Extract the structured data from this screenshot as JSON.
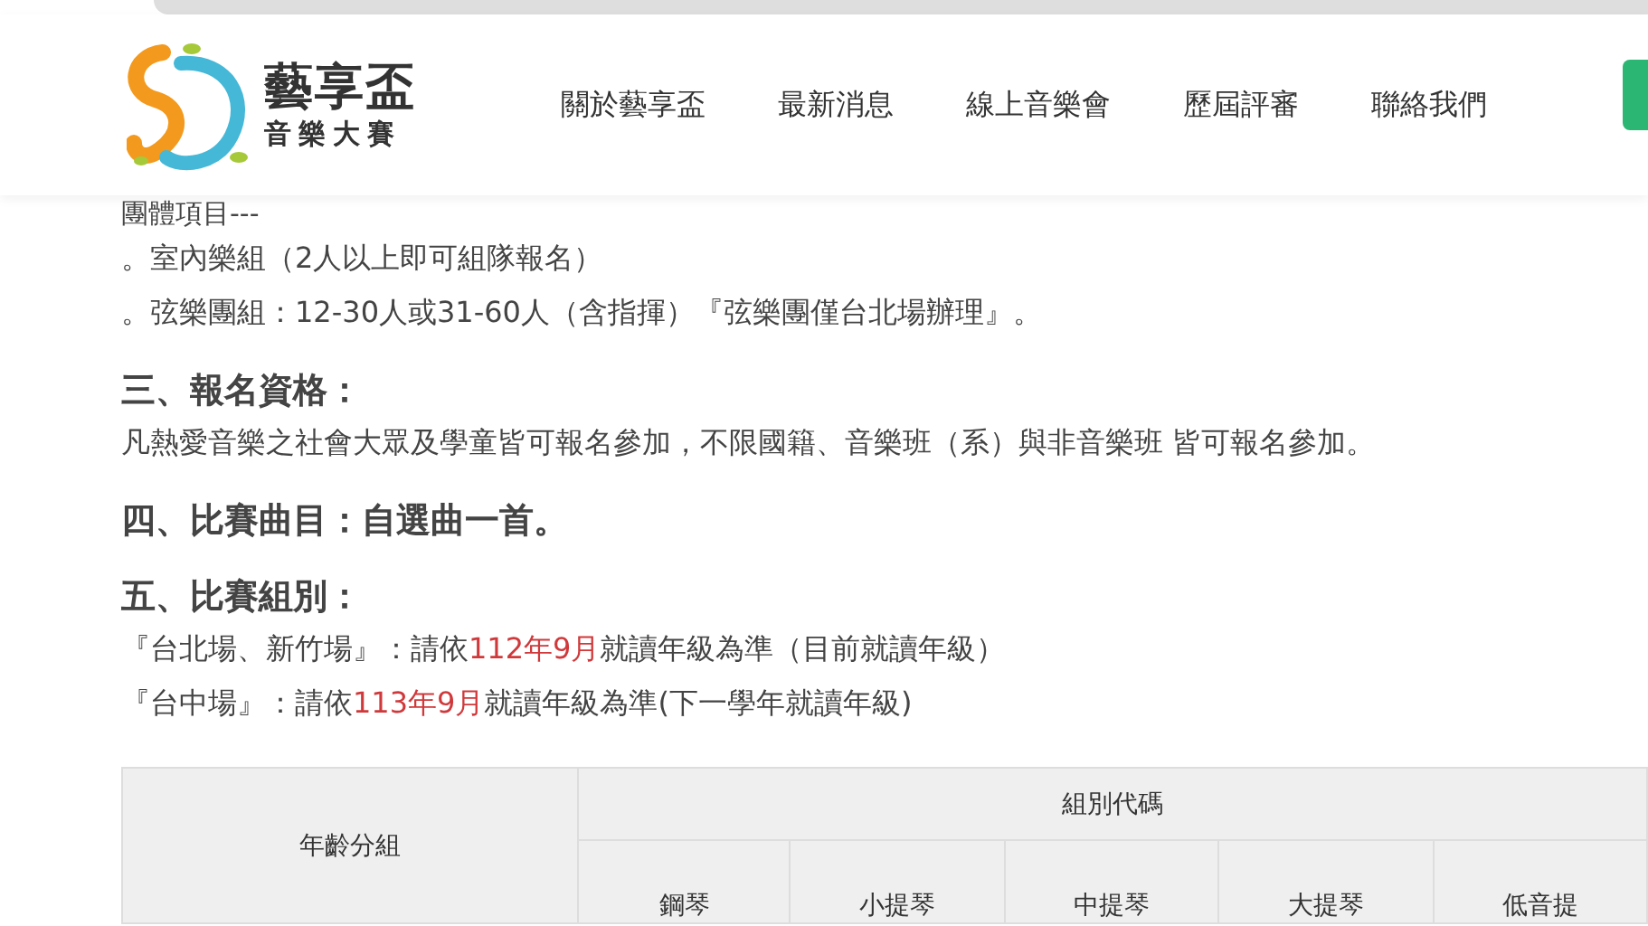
{
  "header": {
    "logo_title": "藝享盃",
    "logo_subtitle": "音樂大賽",
    "nav": [
      "關於藝享盃",
      "最新消息",
      "線上音樂會",
      "歷屆評審",
      "聯絡我們"
    ]
  },
  "content": [
    {
      "kind": "clipped",
      "text": "團體項目---"
    },
    {
      "kind": "line",
      "parts": [
        {
          "text": "。室內樂組（2人以上即可組隊報名）",
          "highlight": false
        }
      ]
    },
    {
      "kind": "line",
      "parts": [
        {
          "text": "。弦樂團組：12-30人或31-60人（含指揮）『弦樂團僅台北場辦理』。",
          "highlight": false
        }
      ]
    },
    {
      "kind": "heading",
      "text": "三、報名資格："
    },
    {
      "kind": "line",
      "parts": [
        {
          "text": "凡熱愛音樂之社會大眾及學童皆可報名參加，不限國籍、音樂班（系）與非音樂班 皆可報名參加。",
          "highlight": false
        }
      ]
    },
    {
      "kind": "heading",
      "text": "四、比賽曲目：自選曲一首。"
    },
    {
      "kind": "heading",
      "text": "五、比賽組別："
    },
    {
      "kind": "line",
      "parts": [
        {
          "text": "『台北場、新竹場』：請依",
          "highlight": false
        },
        {
          "text": "112年9月",
          "highlight": true
        },
        {
          "text": "就讀年級為準（目前就讀年級）",
          "highlight": false
        }
      ]
    },
    {
      "kind": "line",
      "parts": [
        {
          "text": "『台中場』：請依",
          "highlight": false
        },
        {
          "text": "113年9月",
          "highlight": true
        },
        {
          "text": "就讀年級為準(下一學年就讀年級)",
          "highlight": false
        }
      ]
    }
  ],
  "table": {
    "row_header": "年齡分組",
    "group_header": "組別代碼",
    "columns": [
      "鋼琴",
      "小提琴",
      "中提琴",
      "大提琴",
      "低音提"
    ]
  }
}
